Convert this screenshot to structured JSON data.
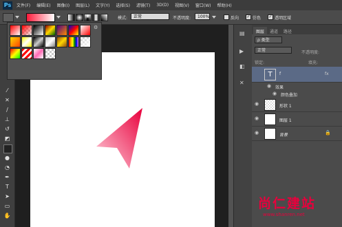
{
  "app": {
    "logo": "Ps"
  },
  "menu": [
    "文件(F)",
    "编辑(E)",
    "图像(I)",
    "图层(L)",
    "文字(Y)",
    "选择(S)",
    "滤镜(T)",
    "3D(D)",
    "视图(V)",
    "窗口(W)",
    "帮助(H)"
  ],
  "options": {
    "mode_label": "模式:",
    "mode_value": "正常",
    "opacity_label": "不透明度:",
    "opacity_value": "100%",
    "reverse_label": "反向",
    "dither_label": "仿色",
    "transparency_label": "透明区域",
    "reverse_checked": false,
    "dither_checked": true,
    "transparency_checked": true,
    "gradient_colors": [
      "#ff1a3a",
      "#ffffff"
    ]
  },
  "panel": {
    "tabs": [
      "图层",
      "通道",
      "路径"
    ],
    "filter_label": "ρ 类型",
    "blend_mode": "正常",
    "opacity_label": "不透明度:",
    "lock_label": "锁定:",
    "fill_label": "填充:",
    "layers": [
      {
        "name": "f",
        "type": "text",
        "fx": "fx"
      },
      {
        "name": "效果",
        "type": "effects-header"
      },
      {
        "name": "颜色叠加",
        "type": "effect"
      },
      {
        "name": "形状 1",
        "type": "shape"
      },
      {
        "name": "图层 1",
        "type": "pixel"
      },
      {
        "name": "背景",
        "type": "background"
      }
    ]
  },
  "watermark": {
    "title": "尚仁建站",
    "url": "www.shanren.net"
  },
  "colors": {
    "arrow_start": "#e8003c",
    "arrow_end": "#ffd0dc",
    "accent": "#e8003c"
  }
}
